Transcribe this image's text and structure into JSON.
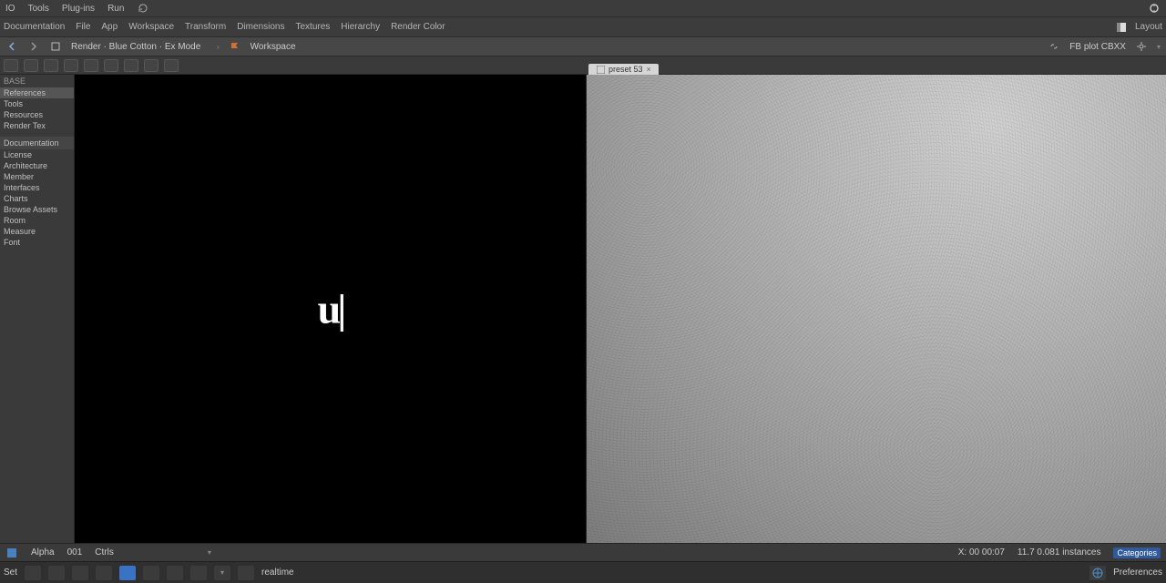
{
  "topbar": {
    "items": [
      "IO",
      "Tools",
      "Plug-ins",
      "Run"
    ]
  },
  "secondbar": {
    "left": [
      "Documentation",
      "File",
      "App",
      "Workspace",
      "Transform",
      "Dimensions",
      "Textures",
      "Hierarchy",
      "Render Color"
    ],
    "right_icon": "panel-icon",
    "right_label": "Layout"
  },
  "pathbar": {
    "nav": [
      "back-icon",
      "forward-icon",
      "file-icon"
    ],
    "path": "Render · Blue Cotton · Ex Mode",
    "divider_icon": "chevron-right-icon",
    "marker_icon": "flag-icon",
    "marker_color": "#d07030",
    "marker_text": "Workspace",
    "right": {
      "link_icon": "link-icon",
      "link_text": "FB plot CBXX",
      "dropdown_icon": "gear-icon"
    }
  },
  "toolbar": {
    "icons": [
      "save-icon",
      "open-icon",
      "copy-icon",
      "cut-icon",
      "paste-icon",
      "sync-icon",
      "grid-icon",
      "layers-icon",
      "export-icon"
    ]
  },
  "sidebar": {
    "header": "BASE",
    "group1": [
      "References",
      "Tools",
      "Resources",
      "Render Tex"
    ],
    "group2_header": "Documentation",
    "group2": [
      "License",
      "Architecture",
      "Member",
      "Interfaces",
      "Charts",
      "Browse Assets",
      "Room",
      "Measure",
      "Font"
    ]
  },
  "leftpane": {
    "logo_text": "u|"
  },
  "rightpane": {
    "tab_icon": "image-icon",
    "tab_label": "preset 53",
    "tab_close": "close-icon"
  },
  "statusbar": {
    "left": [
      "Alpha",
      "001",
      "Ctrls"
    ],
    "sliders": [
      "slider-icon",
      "toggle-icon",
      "toggle-icon",
      "dropdown-icon"
    ],
    "right_a": "X: 00  00:07",
    "right_b": "11.7  0.081 instances",
    "right_chip": "Categories"
  },
  "bottombar": {
    "label": "Set",
    "icons": [
      "terminal-icon",
      "console-icon",
      "keyboard-icon",
      "note-icon",
      "monitor-icon",
      "pause-icon",
      "chart-icon",
      "pointer-icon",
      "cursor-icon",
      "wrench-icon"
    ],
    "mode": "realtime",
    "right_icon": "globe-icon",
    "right_text": "Preferences"
  }
}
